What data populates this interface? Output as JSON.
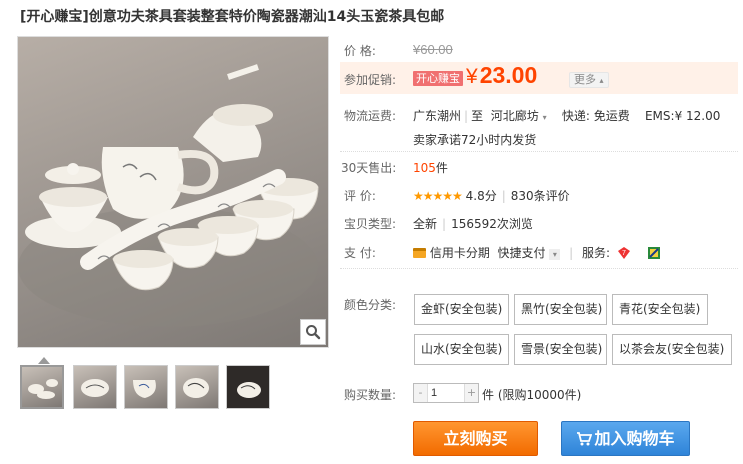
{
  "title": "[开心赚宝]创意功夫茶具套装整套特价陶瓷器潮汕14头玉瓷茶具包邮",
  "price": {
    "label": "价  格:",
    "currency": "¥",
    "original": "60.00"
  },
  "promo": {
    "label": "参加促销:",
    "badge": "开心赚宝",
    "currency": "¥",
    "price": "23.00",
    "more": "更多"
  },
  "shipping": {
    "label": "物流运费:",
    "from": "广东潮州",
    "to_prefix": "至",
    "to": "河北廊坊",
    "express": "快递: 免运费",
    "ems": "EMS:¥ 12.00",
    "promise": "卖家承诺72小时内发货"
  },
  "sales": {
    "label": "30天售出:",
    "count": "105",
    "unit": "件"
  },
  "rating": {
    "label": "评  价:",
    "stars": "★★★★★",
    "score": "4.8分",
    "reviews": "830条评价"
  },
  "item_type": {
    "label": "宝贝类型:",
    "condition": "全新",
    "views": "156592次浏览"
  },
  "payment": {
    "label": "支  付:",
    "credit": "信用卡分期",
    "quick": "快捷支付",
    "service_label": "服务:"
  },
  "sku": {
    "label": "颜色分类:",
    "options": [
      "金虾(安全包装)",
      "黑竹(安全包装)",
      "青花(安全包装)",
      "山水(安全包装)",
      "雪景(安全包装)",
      "以茶会友(安全包装)"
    ]
  },
  "quantity": {
    "label": "购买数量:",
    "value": "1",
    "minus": "-",
    "plus": "+",
    "unit_limit": "件 (限购10000件)"
  },
  "actions": {
    "buy": "立刻购买",
    "cart": "加入购物车"
  },
  "icons": {
    "zoom": "magnifier-icon",
    "cart": "cart-icon",
    "credit": "credit-card-icon",
    "service1": "seven-day-return-icon",
    "service2": "guarantee-icon"
  },
  "colors": {
    "accent": "#ff4400",
    "buy": "#f26b00",
    "cart": "#2f84d8",
    "promo_bg": "#fff1e8",
    "stars": "#ff9900"
  }
}
